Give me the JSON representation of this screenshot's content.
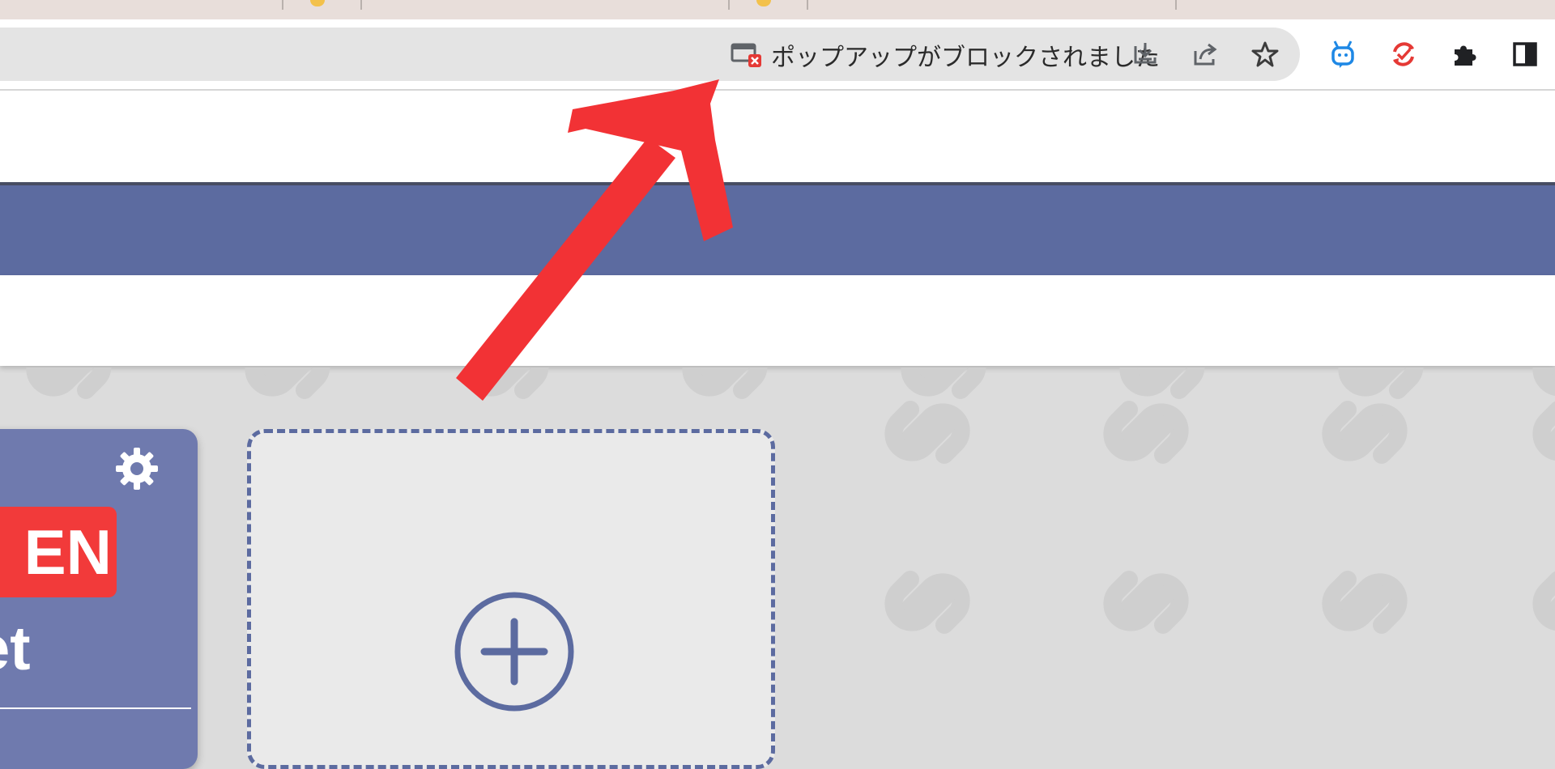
{
  "browser": {
    "popup_blocked_label": "ポップアップがブロックされました",
    "icons": [
      "popup-blocked-icon",
      "install-icon",
      "share-icon",
      "bookmark-star-icon",
      "extension-robot-icon",
      "extension-sync-icon",
      "extensions-puzzle-icon",
      "side-panel-icon"
    ]
  },
  "card": {
    "badge": "EN",
    "label": "et",
    "badge_color": "#f23a3a",
    "card_color": "#6f7aae"
  },
  "colors": {
    "banner": "#5c6ba0",
    "annotation_arrow": "#f23235",
    "popup_icon_red": "#e53935"
  }
}
